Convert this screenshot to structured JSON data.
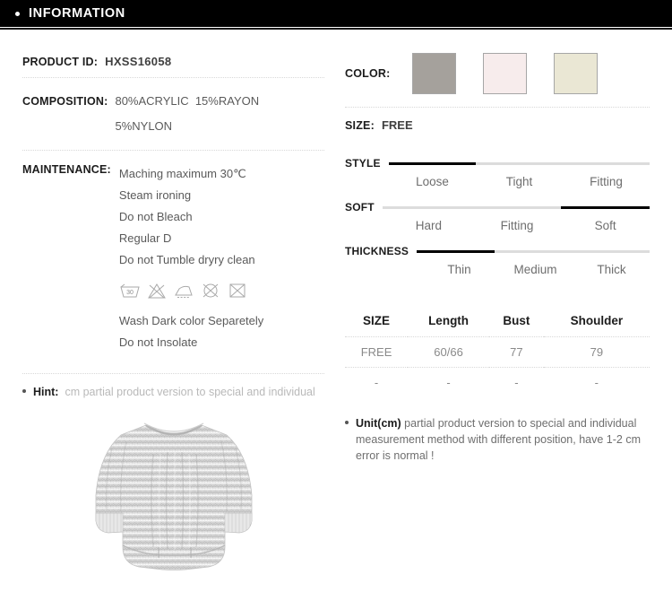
{
  "header": {
    "title": "INFORMATION",
    "bullet": "bullet-dot"
  },
  "left": {
    "product_id": {
      "label": "PRODUCT ID:",
      "value": "HXSS16058"
    },
    "composition": {
      "label": "COMPOSITION:",
      "lines": [
        "80%ACRYLIC  15%RAYON",
        "5%NYLON"
      ]
    },
    "maintenance": {
      "label": "MAINTENANCE:",
      "lines": [
        "Maching maximum 30℃",
        "Steam ironing",
        "Do not Bleach",
        "Regular D",
        "Do not Tumble dryry clean"
      ],
      "symbols": [
        {
          "name": "wash-30-icon",
          "caption": "30"
        },
        {
          "name": "do-not-bleach-icon",
          "caption": ""
        },
        {
          "name": "iron-icon",
          "caption": ""
        },
        {
          "name": "do-not-tumble-dry-icon",
          "caption": ""
        },
        {
          "name": "do-not-dry-clean-icon",
          "caption": ""
        }
      ],
      "post_lines": [
        "Wash Dark color Separetely",
        "Do not Insolate"
      ]
    },
    "hint": {
      "label": "Hint:",
      "text": "cm partial product version to special and individual"
    },
    "garment": {
      "alt": "gray knit oversized sweater",
      "base_color": "#d8d8d8",
      "shade_color": "#b4b4b4"
    }
  },
  "right": {
    "color": {
      "label": "COLOR:",
      "swatches": [
        {
          "name": "swatch-gray",
          "hex": "#a5a19c"
        },
        {
          "name": "swatch-pink",
          "hex": "#f7ecec"
        },
        {
          "name": "swatch-cream",
          "hex": "#eae7d4"
        }
      ]
    },
    "size": {
      "label": "SIZE:",
      "value": "FREE"
    },
    "scales": [
      {
        "label": "STYLE",
        "options": [
          "Loose",
          "Tight",
          "Fitting"
        ],
        "selected_index": 0
      },
      {
        "label": "SOFT",
        "options": [
          "Hard",
          "Fitting",
          "Soft"
        ],
        "selected_index": 2
      },
      {
        "label": "THICKNESS",
        "options": [
          "Thin",
          "Medium",
          "Thick"
        ],
        "selected_index": 0
      }
    ],
    "size_table": {
      "headers": [
        "SIZE",
        "Length",
        "Bust",
        "Shoulder"
      ],
      "rows": [
        [
          "FREE",
          "60/66",
          "77",
          "79"
        ],
        [
          "-",
          "-",
          "-",
          "-"
        ]
      ]
    },
    "unit_note": {
      "strong": "Unit(cm)",
      "text": " partial product version to special and individual measurement method with different position, have 1-2 cm error is normal !"
    }
  },
  "colors": {
    "accent_black": "#000000",
    "rule_gray": "#dcdcdc",
    "dotted_gray": "#d8d8d8"
  }
}
